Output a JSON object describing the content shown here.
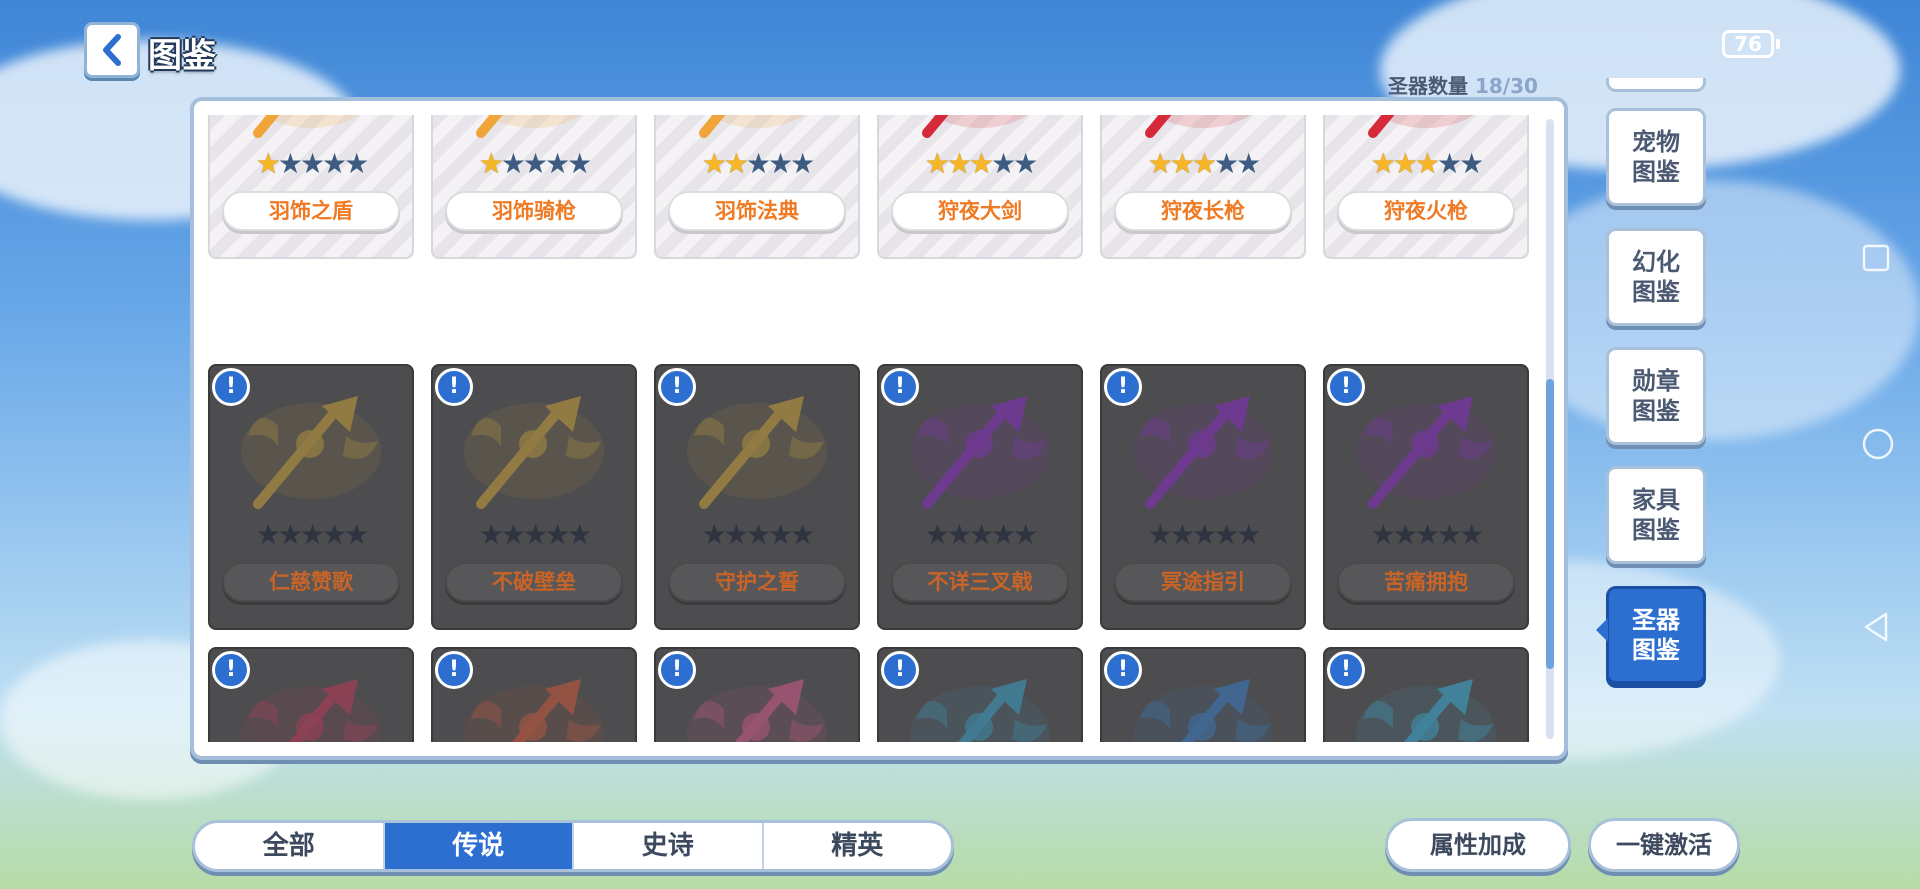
{
  "header": {
    "title": "图鉴",
    "battery": "76"
  },
  "collection": {
    "label": "圣器数量",
    "value": "18/30"
  },
  "rows": [
    {
      "locked": false,
      "items": [
        {
          "name": "羽饰之盾",
          "stars": 1,
          "color": "#f0a43a"
        },
        {
          "name": "羽饰骑枪",
          "stars": 1,
          "color": "#f0a43a"
        },
        {
          "name": "羽饰法典",
          "stars": 2,
          "color": "#f0a43a"
        },
        {
          "name": "狩夜大剑",
          "stars": 3,
          "color": "#d62a3a"
        },
        {
          "name": "狩夜长枪",
          "stars": 3,
          "color": "#d62a3a"
        },
        {
          "name": "狩夜火枪",
          "stars": 3,
          "color": "#d62a3a"
        }
      ]
    },
    {
      "locked": true,
      "items": [
        {
          "name": "仁慈赞歌",
          "stars": 0,
          "color": "#c9a23a"
        },
        {
          "name": "不破壁垒",
          "stars": 0,
          "color": "#c9a23a"
        },
        {
          "name": "守护之誓",
          "stars": 0,
          "color": "#c9a23a"
        },
        {
          "name": "不详三叉戟",
          "stars": 0,
          "color": "#8a2cc4"
        },
        {
          "name": "冥途指引",
          "stars": 0,
          "color": "#8a2cc4"
        },
        {
          "name": "苦痛拥抱",
          "stars": 0,
          "color": "#8a2cc4"
        }
      ]
    },
    {
      "locked": true,
      "items": [
        {
          "name": "",
          "stars": 0,
          "color": "#c03a5a"
        },
        {
          "name": "",
          "stars": 0,
          "color": "#d05a3a"
        },
        {
          "name": "",
          "stars": 0,
          "color": "#d65a8a"
        },
        {
          "name": "",
          "stars": 0,
          "color": "#3aa0c9"
        },
        {
          "name": "",
          "stars": 0,
          "color": "#3a7fc9"
        },
        {
          "name": "",
          "stars": 0,
          "color": "#3ab0d9"
        }
      ]
    }
  ],
  "side_tabs": [
    {
      "label": "宠物\n图鉴",
      "active": false
    },
    {
      "label": "幻化\n图鉴",
      "active": false
    },
    {
      "label": "勋章\n图鉴",
      "active": false
    },
    {
      "label": "家具\n图鉴",
      "active": false
    },
    {
      "label": "圣器\n图鉴",
      "active": true
    }
  ],
  "rarity_tabs": [
    {
      "label": "全部",
      "active": false
    },
    {
      "label": "传说",
      "active": true
    },
    {
      "label": "史诗",
      "active": false
    },
    {
      "label": "精英",
      "active": false
    }
  ],
  "buttons": {
    "attribute_bonus": "属性加成",
    "activate_all": "一键激活"
  },
  "info_symbol": "!"
}
